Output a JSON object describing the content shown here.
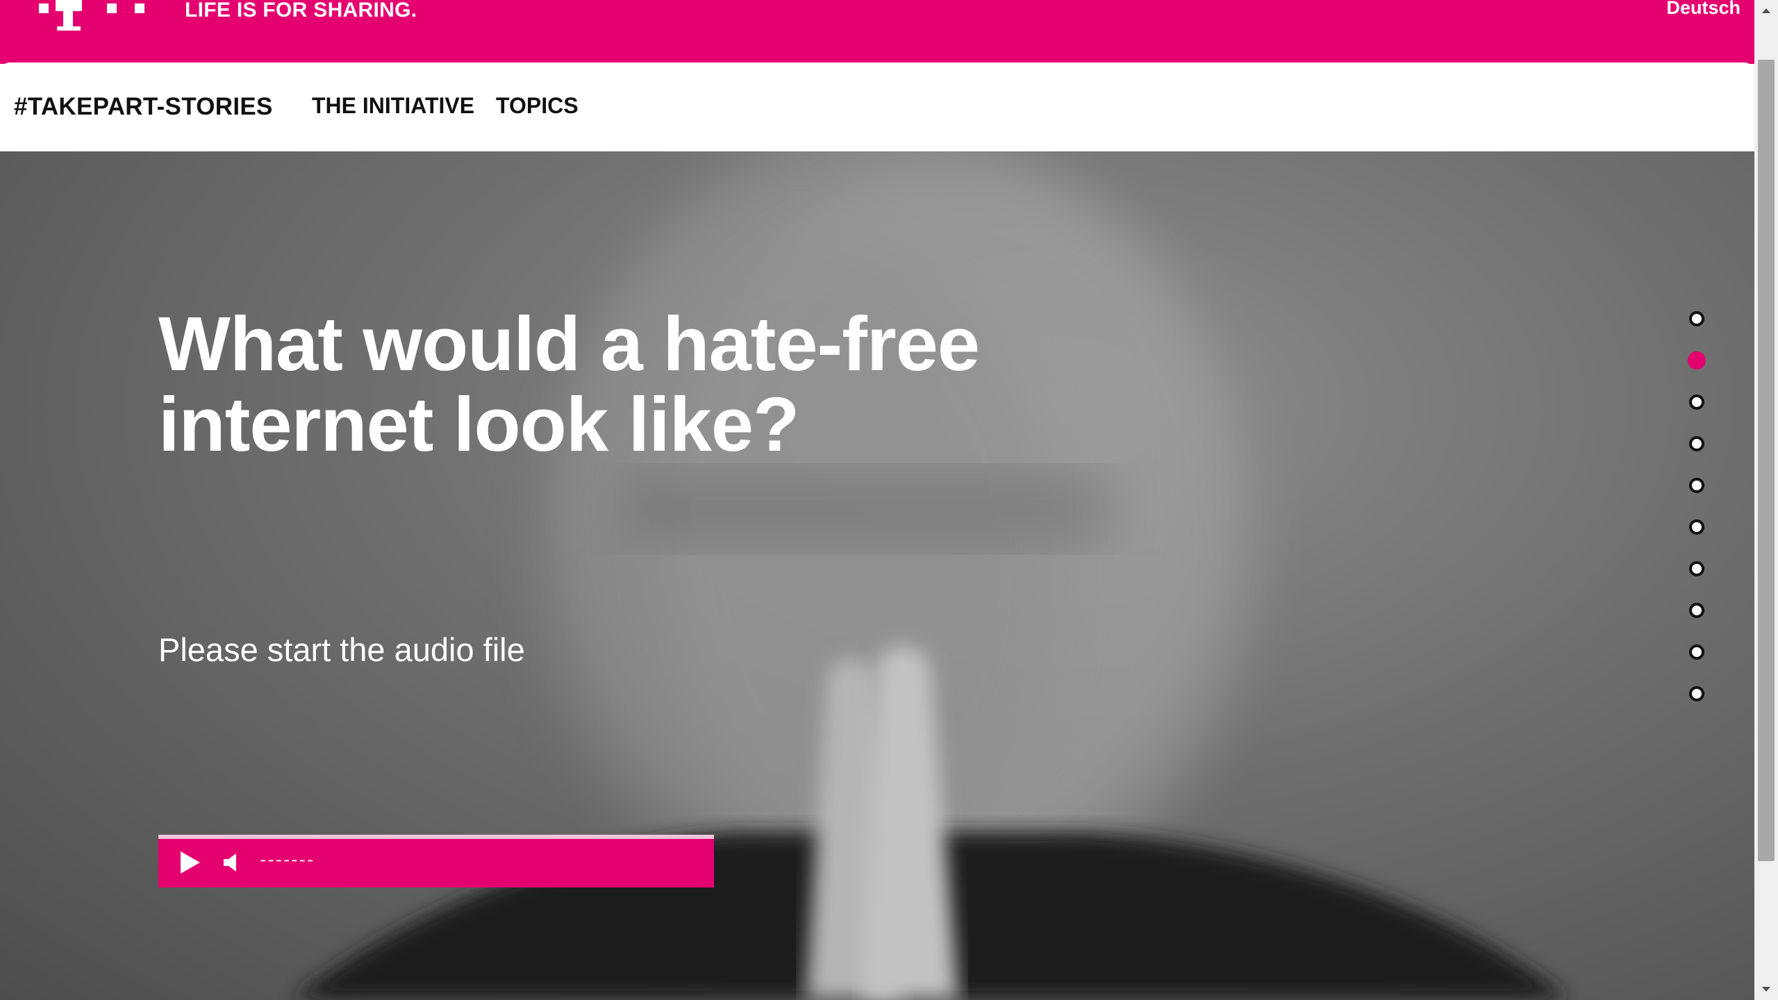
{
  "colors": {
    "brand_magenta": "#e5006f",
    "nav_text": "#111111",
    "hero_text": "#ffffff"
  },
  "topbar": {
    "logo_icon": "telekom-t-logo-icon",
    "slogan": "LIFE IS FOR SHARING.",
    "language_link": "Deutsch"
  },
  "nav": {
    "brand": "#TAKEPART-STORIES",
    "items": [
      {
        "label": "THE INITIATIVE"
      },
      {
        "label": "TOPICS"
      }
    ]
  },
  "hero": {
    "headline_line1": "What would a hate-free",
    "headline_line2": "internet look like?",
    "audio_prompt": "Please start the audio file",
    "audio": {
      "play_icon": "play-icon",
      "volume_icon": "volume-icon",
      "time_display": "-------"
    }
  },
  "slide_nav": {
    "count": 10,
    "active_index": 1
  },
  "scrollbar": {
    "up_icon": "scroll-up-arrow-icon",
    "down_icon": "scroll-down-arrow-icon"
  }
}
